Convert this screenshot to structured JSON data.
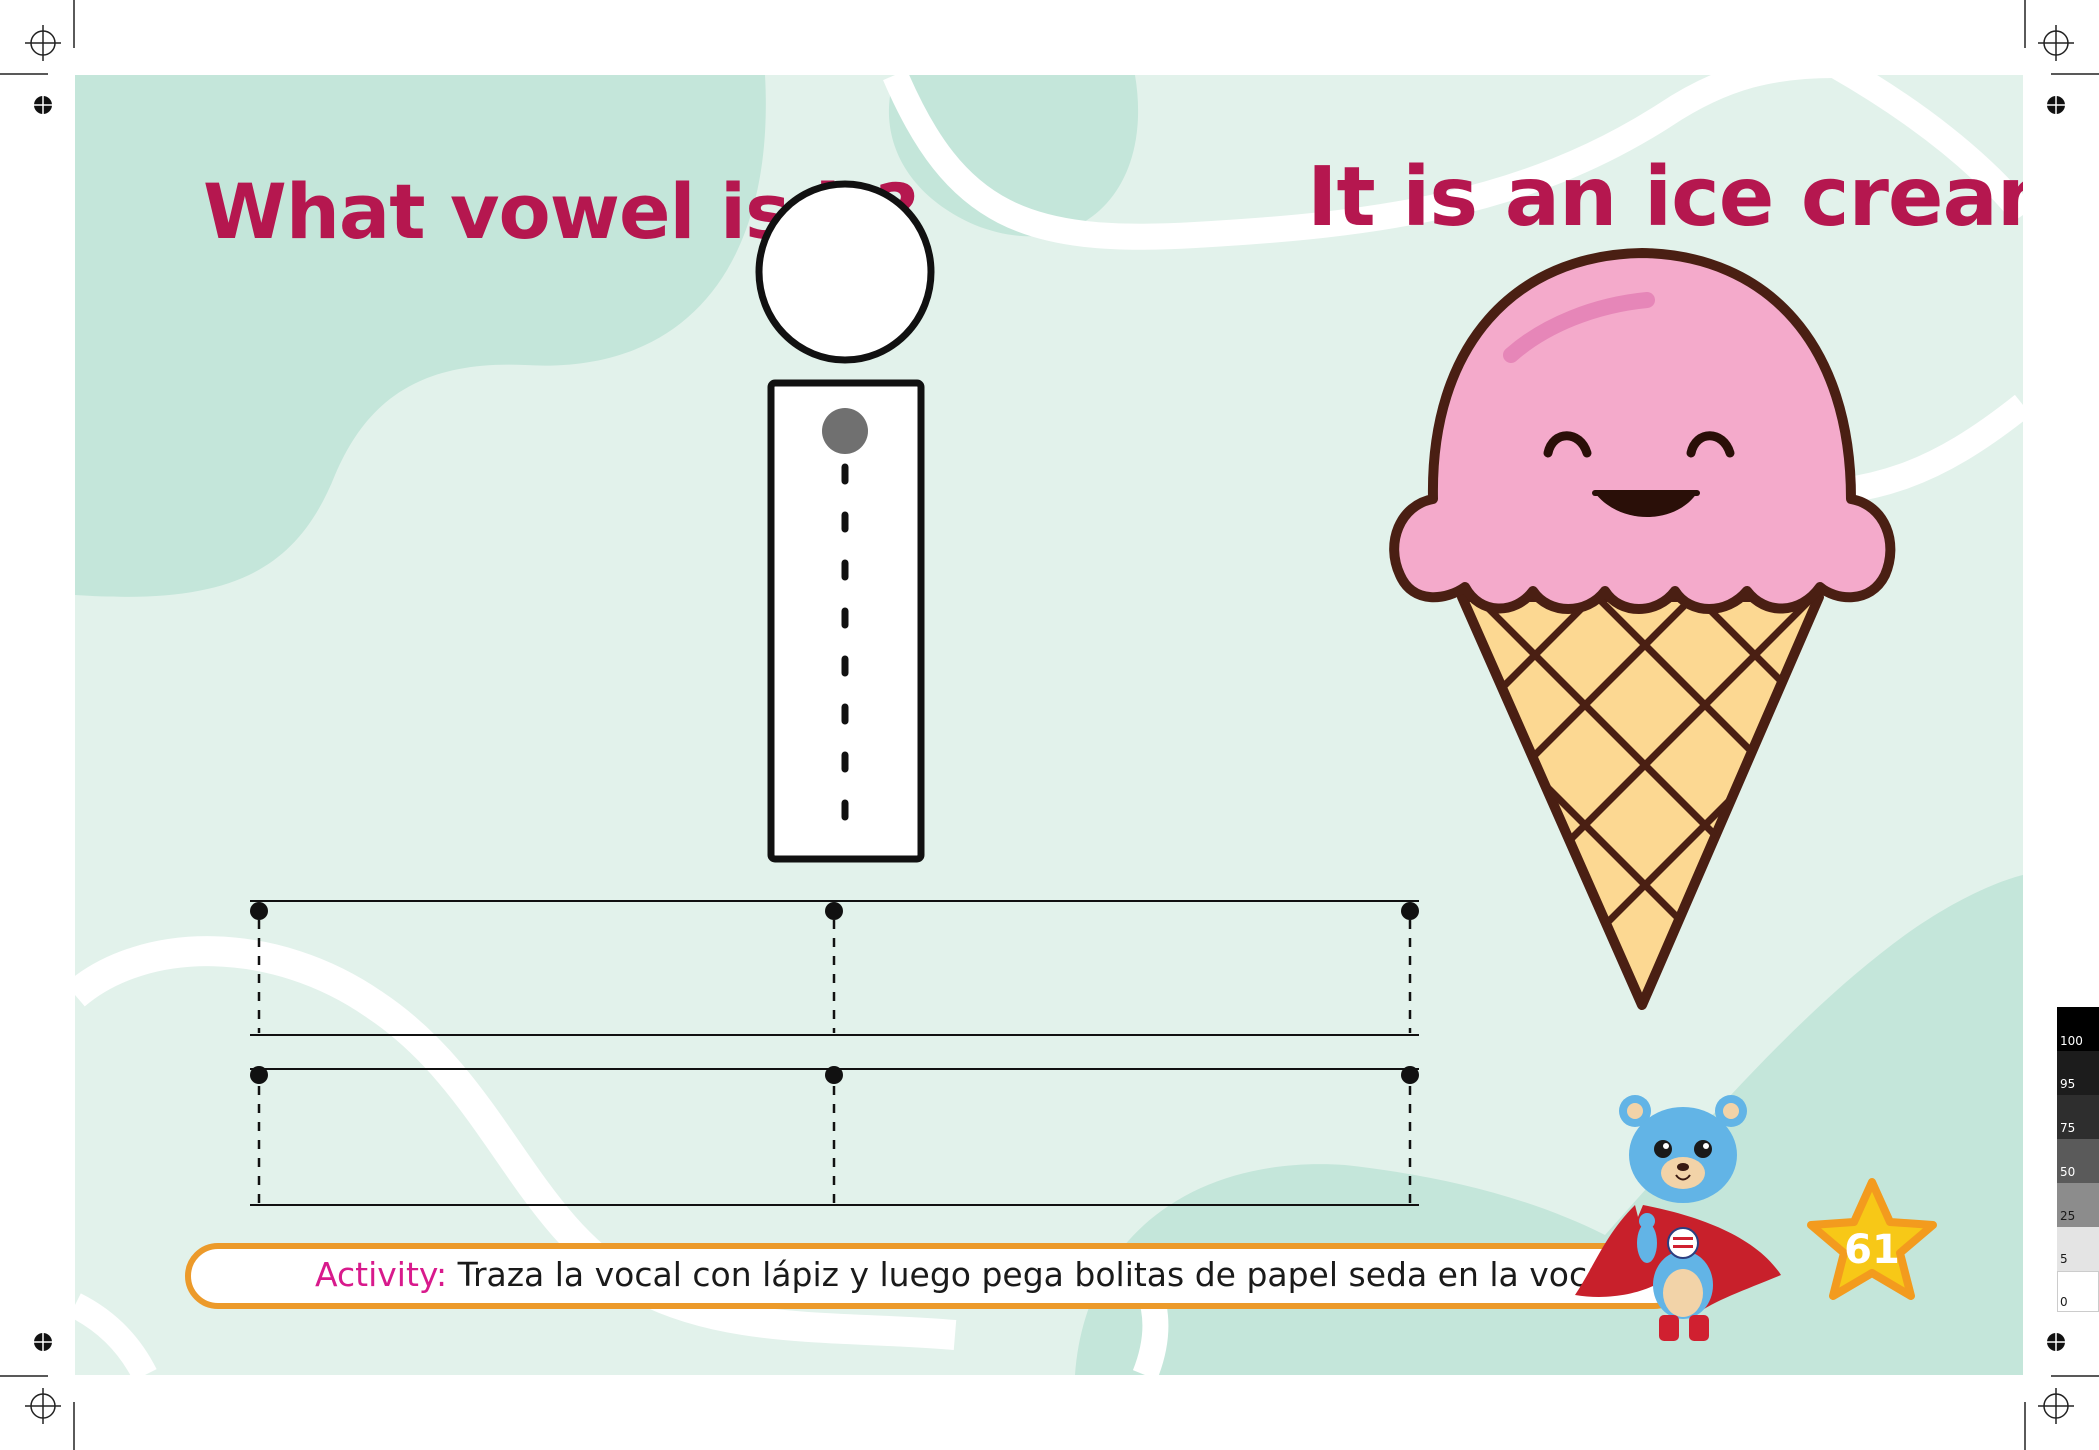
{
  "worksheet": {
    "question": "What vowel is it?",
    "answer_text": "It is an ice cream",
    "activity_label": "Activity:",
    "activity_text": " Traza la vocal con lápiz y luego pega bolitas de papel seda en la vocal.",
    "page_number": "61"
  },
  "colors": {
    "title": "#b5174f",
    "activity_label": "#d81a8c",
    "activity_border": "#ec9a2a",
    "background": "#e2f2eb",
    "blob": "#c4e6da",
    "ice_cream_scoop": "#f4aacb",
    "cone": "#fcd892",
    "star": "#f7c817"
  },
  "print_marks": {
    "color_strip": [
      "100",
      "95",
      "75",
      "50",
      "25",
      "5",
      "0"
    ]
  },
  "icons": [
    "letter-i-tracing-icon",
    "ice-cream-cone-icon",
    "bear-superhero-mascot-icon",
    "star-icon",
    "registration-mark-icon"
  ]
}
